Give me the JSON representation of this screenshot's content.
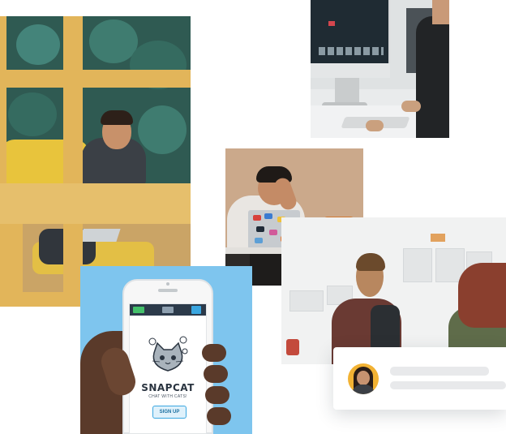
{
  "colors": {
    "background": "#ffffff",
    "phone_backdrop": "#7ec5ee",
    "wood": "#e2b55a",
    "card_avatar_bg": "#f2b233",
    "skeleton": "#e8e9eb",
    "app_accent": "#3aa6e0"
  },
  "photos": [
    {
      "name": "lounge-photo"
    },
    {
      "name": "imac-desk-photo"
    },
    {
      "name": "stickered-laptop-photo"
    },
    {
      "name": "whiteboard-meeting-photo"
    },
    {
      "name": "phone-app-photo"
    }
  ],
  "phone_app": {
    "name": "SNAPCAT",
    "tagline": "CHAT WITH CATS!",
    "signup_label": "SIGN UP"
  },
  "profile_card": {
    "avatar": "avatar-photo",
    "lines": [
      "placeholder-line",
      "placeholder-line"
    ]
  }
}
